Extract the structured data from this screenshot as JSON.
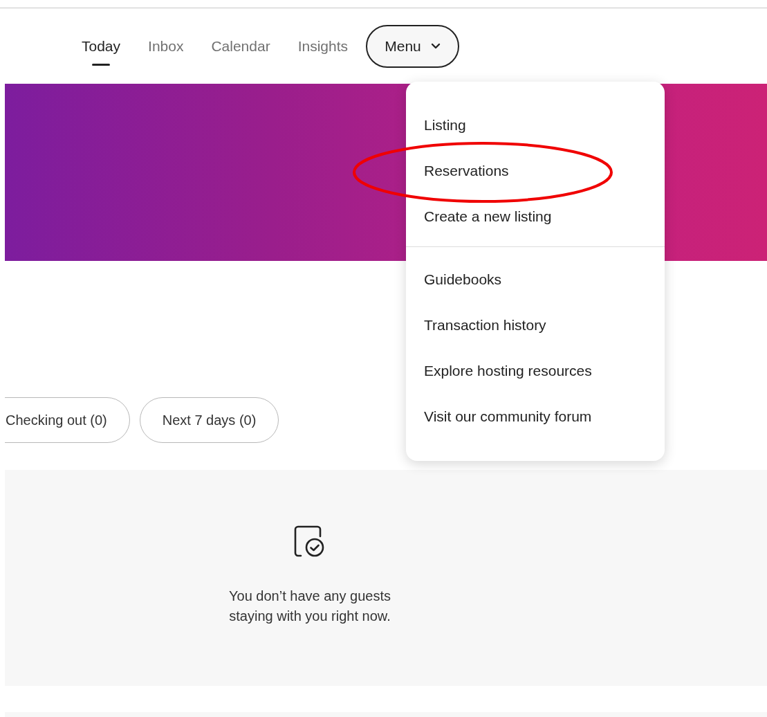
{
  "nav": {
    "tabs": [
      {
        "label": "Today",
        "selected": true
      },
      {
        "label": "Inbox",
        "selected": false
      },
      {
        "label": "Calendar",
        "selected": false
      },
      {
        "label": "Insights",
        "selected": false
      }
    ],
    "menu_button": {
      "label": "Menu",
      "expanded": true
    }
  },
  "menu": {
    "sections": [
      [
        {
          "label": "Listing",
          "highlighted": false
        },
        {
          "label": "Reservations",
          "highlighted": true
        },
        {
          "label": "Create a new listing",
          "highlighted": false
        }
      ],
      [
        {
          "label": "Guidebooks",
          "highlighted": false
        },
        {
          "label": "Transaction history",
          "highlighted": false
        },
        {
          "label": "Explore hosting resources",
          "highlighted": false
        },
        {
          "label": "Visit our community forum",
          "highlighted": false
        }
      ]
    ]
  },
  "filters": [
    {
      "label": "Checking out (0)",
      "selected": false
    },
    {
      "label": "Next 7 days (0)",
      "selected": false
    }
  ],
  "empty_state": {
    "message": "You don’t have any guests staying with you right now."
  }
}
